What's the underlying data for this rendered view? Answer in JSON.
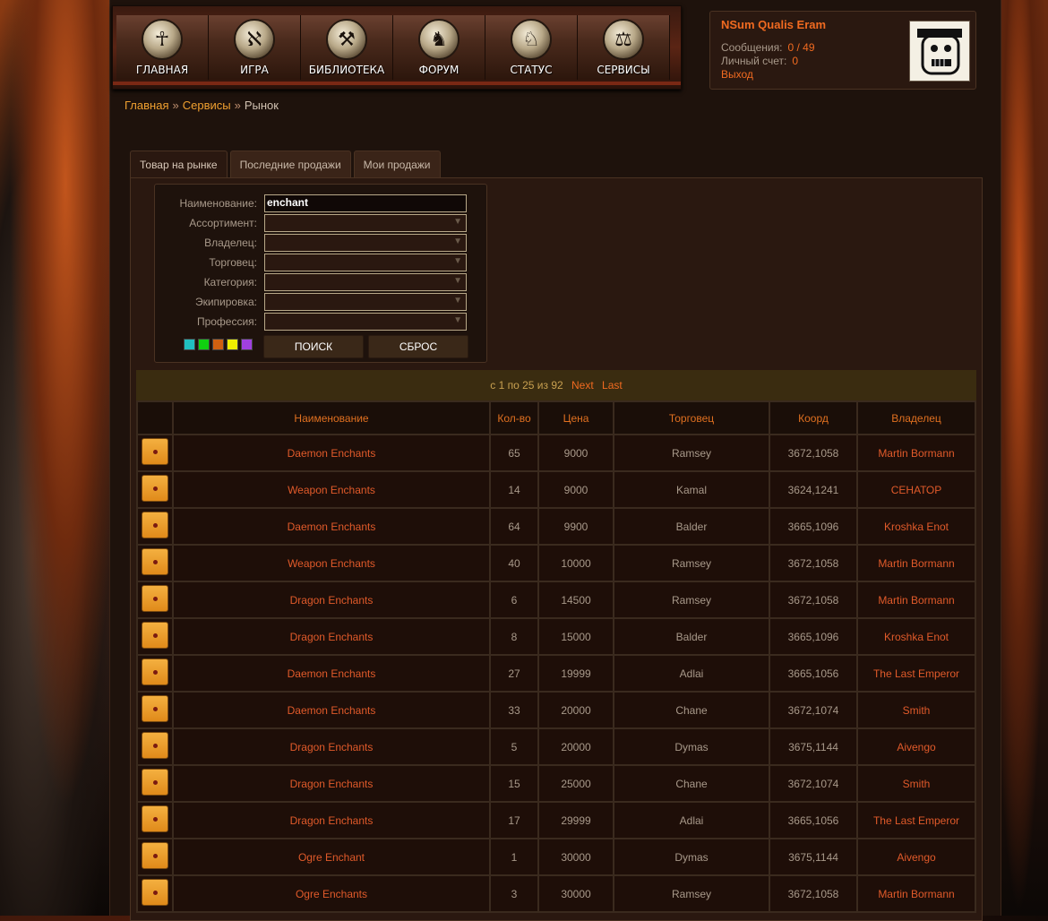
{
  "nav": {
    "items": [
      {
        "label": "ГЛАВНАЯ",
        "icon": "ankh-icon",
        "glyph": "☥"
      },
      {
        "label": "ИГРА",
        "icon": "rune-icon",
        "glyph": "ℵ"
      },
      {
        "label": "БИБЛИОТЕКА",
        "icon": "anvil-icon",
        "glyph": "⚒"
      },
      {
        "label": "ФОРУМ",
        "icon": "helmet-icon",
        "glyph": "♞"
      },
      {
        "label": "СТАТУС",
        "icon": "horseman-icon",
        "glyph": "♘"
      },
      {
        "label": "СЕРВИСЫ",
        "icon": "scales-icon",
        "glyph": "⚖"
      }
    ]
  },
  "user": {
    "name": "NSum Qualis Eram",
    "messages_label": "Сообщения:",
    "messages_value": "0 / 49",
    "account_label": "Личный счет:",
    "account_value": "0",
    "logout": "Выход"
  },
  "breadcrumb": {
    "home": "Главная",
    "services": "Сервисы",
    "current": "Рынок"
  },
  "tabs": [
    "Товар на рынке",
    "Последние продажи",
    "Мои продажи"
  ],
  "filters": {
    "rows": [
      {
        "label": "Наименование:",
        "value": "enchant",
        "type": "text"
      },
      {
        "label": "Ассортимент:",
        "value": "",
        "type": "select"
      },
      {
        "label": "Владелец:",
        "value": "",
        "type": "select"
      },
      {
        "label": "Торговец:",
        "value": "",
        "type": "select"
      },
      {
        "label": "Категория:",
        "value": "",
        "type": "select"
      },
      {
        "label": "Экипировка:",
        "value": "",
        "type": "select"
      },
      {
        "label": "Профессия:",
        "value": "",
        "type": "select"
      }
    ],
    "swatches": [
      "#20c0c0",
      "#10d010",
      "#d06010",
      "#f0f000",
      "#a040e0"
    ],
    "search_button": "ПОИСК",
    "reset_button": "СБРОС"
  },
  "pager": {
    "text": "с 1 по 25 из 92",
    "next": "Next",
    "last": "Last"
  },
  "table": {
    "headers": [
      "Наименование",
      "Кол-во",
      "Цена",
      "Торговец",
      "Коорд",
      "Владелец"
    ],
    "rows": [
      [
        "Daemon Enchants",
        "65",
        "9000",
        "Ramsey",
        "3672,1058",
        "Martin Bormann"
      ],
      [
        "Weapon Enchants",
        "14",
        "9000",
        "Kamal",
        "3624,1241",
        "СЕНАТОР"
      ],
      [
        "Daemon Enchants",
        "64",
        "9900",
        "Balder",
        "3665,1096",
        "Kroshka Enot"
      ],
      [
        "Weapon Enchants",
        "40",
        "10000",
        "Ramsey",
        "3672,1058",
        "Martin Bormann"
      ],
      [
        "Dragon Enchants",
        "6",
        "14500",
        "Ramsey",
        "3672,1058",
        "Martin Bormann"
      ],
      [
        "Dragon Enchants",
        "8",
        "15000",
        "Balder",
        "3665,1096",
        "Kroshka Enot"
      ],
      [
        "Daemon Enchants",
        "27",
        "19999",
        "Adlai",
        "3665,1056",
        "The Last Emperor"
      ],
      [
        "Daemon Enchants",
        "33",
        "20000",
        "Chane",
        "3672,1074",
        "Smith"
      ],
      [
        "Dragon Enchants",
        "5",
        "20000",
        "Dymas",
        "3675,1144",
        "Aivengo"
      ],
      [
        "Dragon Enchants",
        "15",
        "25000",
        "Chane",
        "3672,1074",
        "Smith"
      ],
      [
        "Dragon Enchants",
        "17",
        "29999",
        "Adlai",
        "3665,1056",
        "The Last Emperor"
      ],
      [
        "Ogre Enchant",
        "1",
        "30000",
        "Dymas",
        "3675,1144",
        "Aivengo"
      ],
      [
        "Ogre Enchants",
        "3",
        "30000",
        "Ramsey",
        "3672,1058",
        "Martin Bormann"
      ]
    ]
  }
}
